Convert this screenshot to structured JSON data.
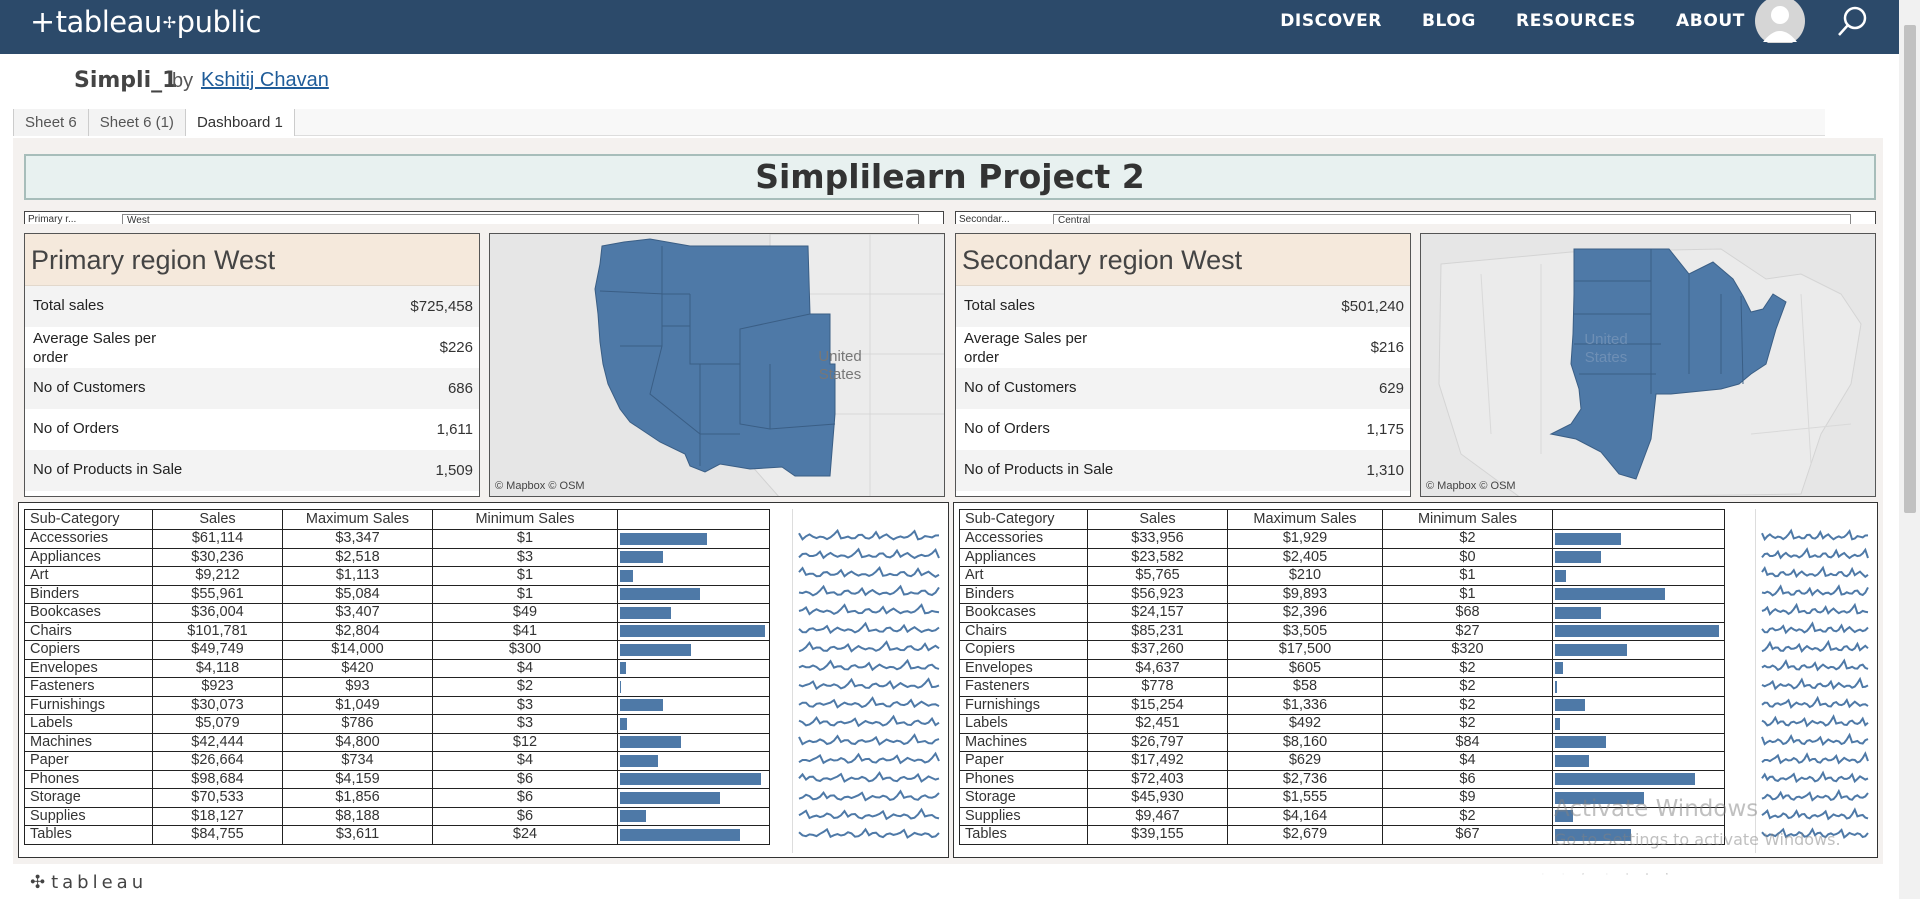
{
  "nav": {
    "logo_text": "tableau",
    "logo_suffix": "public",
    "links": [
      "DISCOVER",
      "BLOG",
      "RESOURCES",
      "ABOUT"
    ]
  },
  "viz": {
    "name": "Simpli_1",
    "by": "by",
    "author": "Kshitij Chavan"
  },
  "tabs": [
    "Sheet 6",
    "Sheet 6 (1)",
    "Dashboard 1"
  ],
  "dashboard": {
    "title": "Simplilearn Project 2",
    "primary_filter_label": "Primary r...",
    "primary_filter_value": "West",
    "secondary_filter_label": "Secondar...",
    "secondary_filter_value": "Central",
    "map_label": "United States",
    "map_attr": "© Mapbox  © OSM",
    "accent": "#4e79a7"
  },
  "kpi_labels": [
    "Total sales",
    "Average Sales per order",
    "No of Customers",
    "No of Orders",
    "No of Products in Sale"
  ],
  "primary": {
    "heading": "Primary region  West",
    "values": [
      "$725,458",
      "$226",
      "686",
      "1,611",
      "1,509"
    ]
  },
  "secondary": {
    "heading": "Secondary region West",
    "values": [
      "$501,240",
      "$216",
      "629",
      "1,175",
      "1,310"
    ]
  },
  "table_headers": [
    "Sub-Category",
    "Sales",
    "Maximum Sales",
    "Minimum Sales"
  ],
  "primary_table": [
    {
      "name": "Accessories",
      "sales": "$61,114",
      "max": "$3,347",
      "min": "$1",
      "bar": 0.6
    },
    {
      "name": "Appliances",
      "sales": "$30,236",
      "max": "$2,518",
      "min": "$3",
      "bar": 0.3
    },
    {
      "name": "Art",
      "sales": "$9,212",
      "max": "$1,113",
      "min": "$1",
      "bar": 0.09
    },
    {
      "name": "Binders",
      "sales": "$55,961",
      "max": "$5,084",
      "min": "$1",
      "bar": 0.55
    },
    {
      "name": "Bookcases",
      "sales": "$36,004",
      "max": "$3,407",
      "min": "$49",
      "bar": 0.35
    },
    {
      "name": "Chairs",
      "sales": "$101,781",
      "max": "$2,804",
      "min": "$41",
      "bar": 1.0
    },
    {
      "name": "Copiers",
      "sales": "$49,749",
      "max": "$14,000",
      "min": "$300",
      "bar": 0.49
    },
    {
      "name": "Envelopes",
      "sales": "$4,118",
      "max": "$420",
      "min": "$4",
      "bar": 0.04
    },
    {
      "name": "Fasteners",
      "sales": "$923",
      "max": "$93",
      "min": "$2",
      "bar": 0.01
    },
    {
      "name": "Furnishings",
      "sales": "$30,073",
      "max": "$1,049",
      "min": "$3",
      "bar": 0.3
    },
    {
      "name": "Labels",
      "sales": "$5,079",
      "max": "$786",
      "min": "$3",
      "bar": 0.05
    },
    {
      "name": "Machines",
      "sales": "$42,444",
      "max": "$4,800",
      "min": "$12",
      "bar": 0.42
    },
    {
      "name": "Paper",
      "sales": "$26,664",
      "max": "$734",
      "min": "$4",
      "bar": 0.26
    },
    {
      "name": "Phones",
      "sales": "$98,684",
      "max": "$4,159",
      "min": "$6",
      "bar": 0.97
    },
    {
      "name": "Storage",
      "sales": "$70,533",
      "max": "$1,856",
      "min": "$6",
      "bar": 0.69
    },
    {
      "name": "Supplies",
      "sales": "$18,127",
      "max": "$8,188",
      "min": "$6",
      "bar": 0.18
    },
    {
      "name": "Tables",
      "sales": "$84,755",
      "max": "$3,611",
      "min": "$24",
      "bar": 0.83
    }
  ],
  "secondary_table": [
    {
      "name": "Accessories",
      "sales": "$33,956",
      "max": "$1,929",
      "min": "$2",
      "bar": 0.4
    },
    {
      "name": "Appliances",
      "sales": "$23,582",
      "max": "$2,405",
      "min": "$0",
      "bar": 0.28
    },
    {
      "name": "Art",
      "sales": "$5,765",
      "max": "$210",
      "min": "$1",
      "bar": 0.07
    },
    {
      "name": "Binders",
      "sales": "$56,923",
      "max": "$9,893",
      "min": "$1",
      "bar": 0.67
    },
    {
      "name": "Bookcases",
      "sales": "$24,157",
      "max": "$2,396",
      "min": "$68",
      "bar": 0.28
    },
    {
      "name": "Chairs",
      "sales": "$85,231",
      "max": "$3,505",
      "min": "$27",
      "bar": 1.0
    },
    {
      "name": "Copiers",
      "sales": "$37,260",
      "max": "$17,500",
      "min": "$320",
      "bar": 0.44
    },
    {
      "name": "Envelopes",
      "sales": "$4,637",
      "max": "$605",
      "min": "$2",
      "bar": 0.05
    },
    {
      "name": "Fasteners",
      "sales": "$778",
      "max": "$58",
      "min": "$2",
      "bar": 0.01
    },
    {
      "name": "Furnishings",
      "sales": "$15,254",
      "max": "$1,336",
      "min": "$2",
      "bar": 0.18
    },
    {
      "name": "Labels",
      "sales": "$2,451",
      "max": "$492",
      "min": "$2",
      "bar": 0.03
    },
    {
      "name": "Machines",
      "sales": "$26,797",
      "max": "$8,160",
      "min": "$84",
      "bar": 0.31
    },
    {
      "name": "Paper",
      "sales": "$17,492",
      "max": "$629",
      "min": "$4",
      "bar": 0.21
    },
    {
      "name": "Phones",
      "sales": "$72,403",
      "max": "$2,736",
      "min": "$6",
      "bar": 0.85
    },
    {
      "name": "Storage",
      "sales": "$45,930",
      "max": "$1,555",
      "min": "$9",
      "bar": 0.54
    },
    {
      "name": "Supplies",
      "sales": "$9,467",
      "max": "$4,164",
      "min": "$2",
      "bar": 0.11
    },
    {
      "name": "Tables",
      "sales": "$39,155",
      "max": "$2,679",
      "min": "$67",
      "bar": 0.46
    }
  ],
  "footer": {
    "logo": "tableau"
  },
  "watermark": {
    "line1": "Activate Windows",
    "line2": "Go to Settings to activate Windows."
  }
}
